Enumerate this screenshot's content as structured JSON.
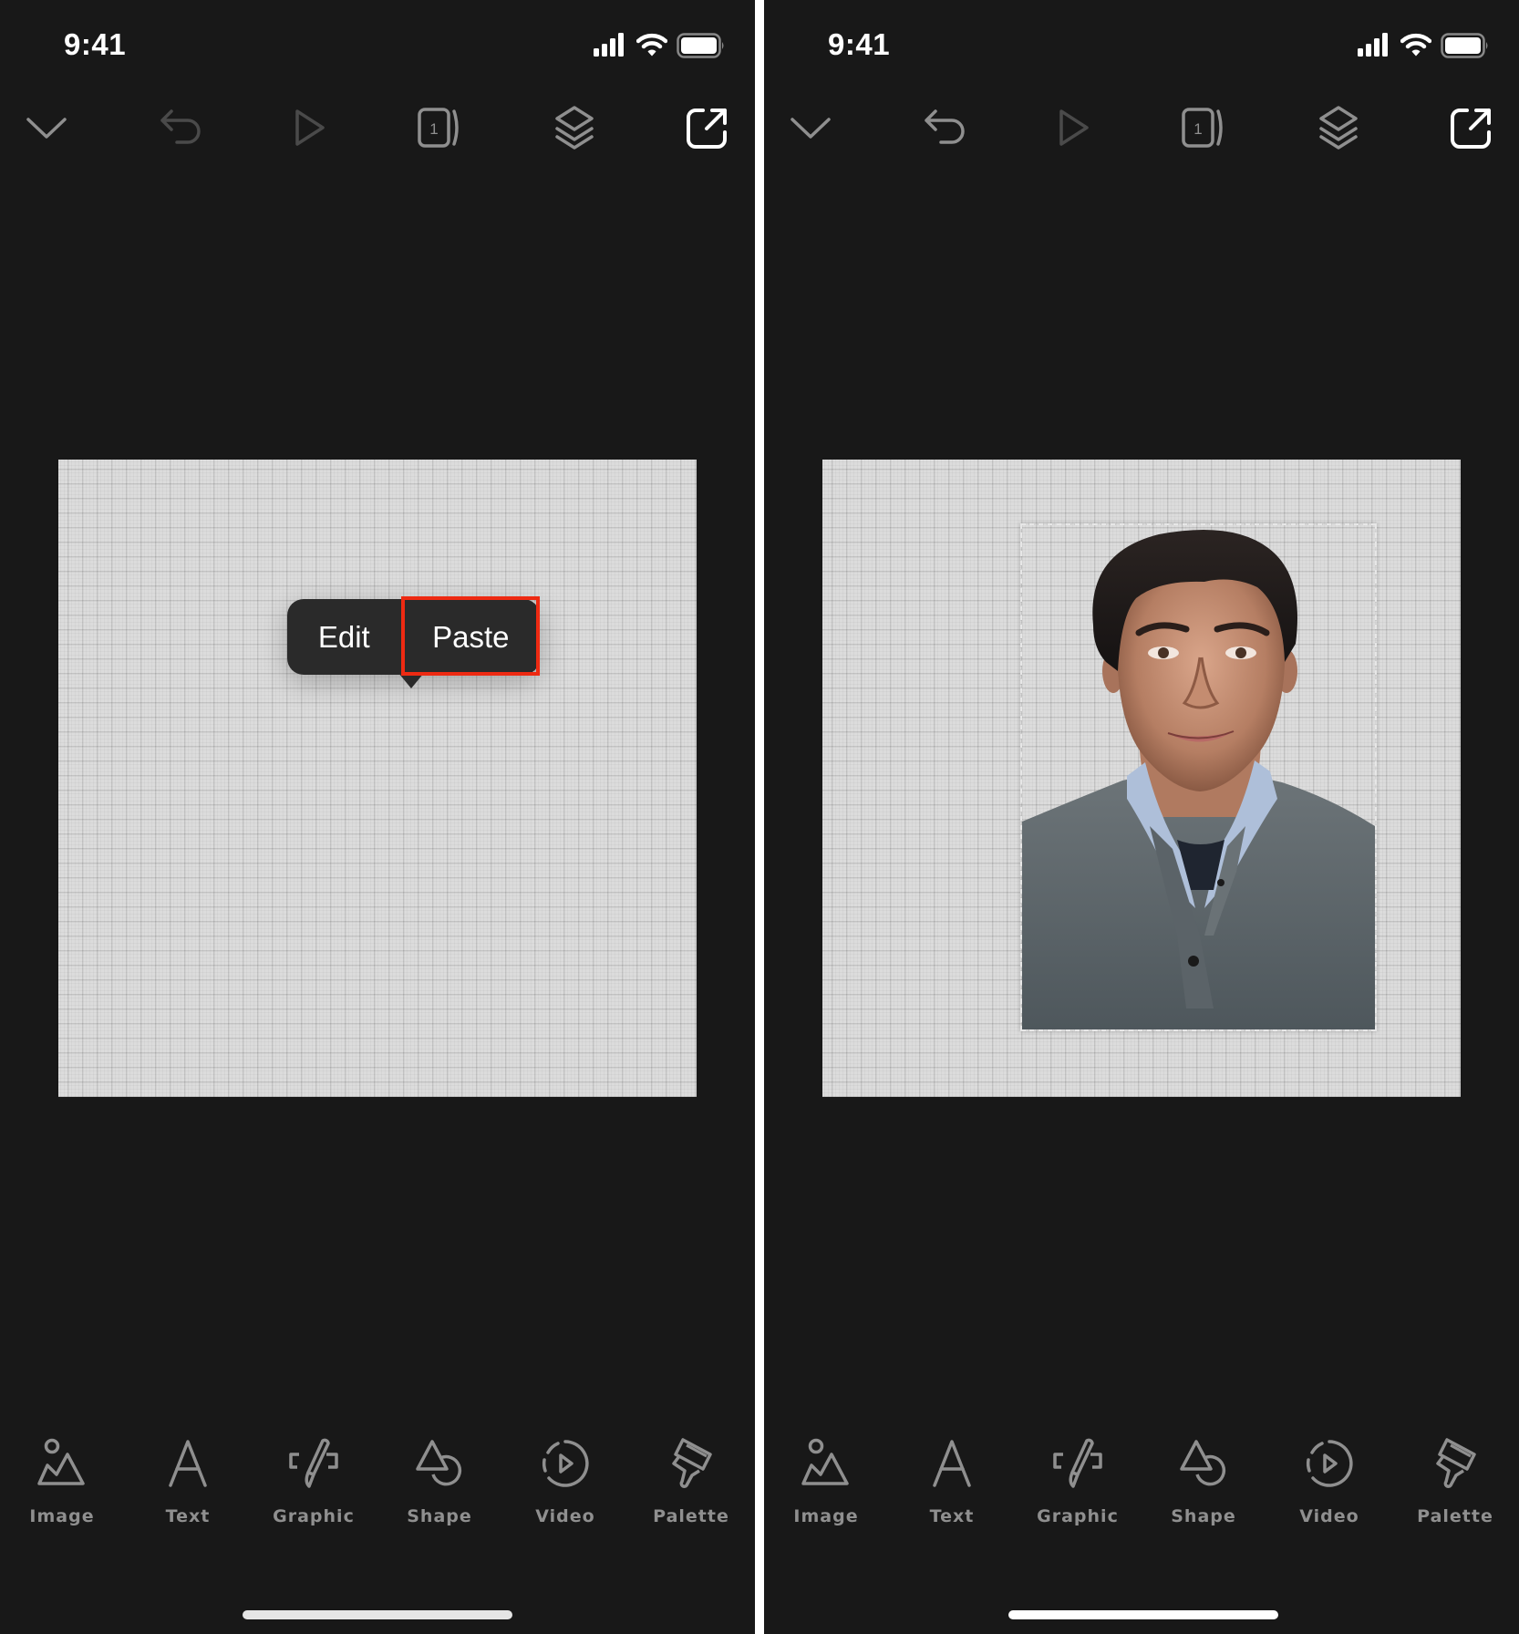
{
  "colors": {
    "background": "#181818",
    "icon_active": "#8f8f8f",
    "icon_disabled": "#4a4a4a",
    "accent_white": "#ffffff",
    "popup_bg": "#2a2a2a",
    "highlight_red": "#ee2a12",
    "canvas_bg": "#dcdcdc"
  },
  "panels": [
    {
      "id": "before",
      "status_bar": {
        "time": "9:41",
        "icons": [
          "cellular-signal-icon",
          "wifi-icon",
          "battery-icon"
        ]
      },
      "top_toolbar": [
        {
          "name": "collapse",
          "icon": "chevron-down-icon",
          "enabled": true
        },
        {
          "name": "undo",
          "icon": "undo-icon",
          "enabled": false
        },
        {
          "name": "preview",
          "icon": "play-icon",
          "enabled": false
        },
        {
          "name": "pages",
          "icon": "pages-icon",
          "page_number": "1",
          "enabled": true
        },
        {
          "name": "layers",
          "icon": "layers-icon",
          "enabled": true
        },
        {
          "name": "share",
          "icon": "share-icon",
          "enabled": true
        }
      ],
      "canvas": {
        "state": "empty"
      },
      "context_menu": {
        "items": [
          {
            "label": "Edit"
          },
          {
            "label": "Paste",
            "highlighted": true
          }
        ]
      },
      "bottom_toolbar": [
        {
          "label": "Image",
          "icon": "image-icon"
        },
        {
          "label": "Text",
          "icon": "text-icon"
        },
        {
          "label": "Graphic",
          "icon": "graphic-icon"
        },
        {
          "label": "Shape",
          "icon": "shape-icon"
        },
        {
          "label": "Video",
          "icon": "video-icon"
        },
        {
          "label": "Palette",
          "icon": "palette-icon"
        }
      ]
    },
    {
      "id": "after",
      "status_bar": {
        "time": "9:41",
        "icons": [
          "cellular-signal-icon",
          "wifi-icon",
          "battery-icon"
        ]
      },
      "top_toolbar": [
        {
          "name": "collapse",
          "icon": "chevron-down-icon",
          "enabled": true
        },
        {
          "name": "undo",
          "icon": "undo-icon",
          "enabled": true
        },
        {
          "name": "preview",
          "icon": "play-icon",
          "enabled": false
        },
        {
          "name": "pages",
          "icon": "pages-icon",
          "page_number": "1",
          "enabled": true
        },
        {
          "name": "layers",
          "icon": "layers-icon",
          "enabled": true
        },
        {
          "name": "share",
          "icon": "share-icon",
          "enabled": true
        }
      ],
      "canvas": {
        "state": "pasted-image-selected",
        "content": "portrait photo of a smiling man in a gray sweater over a light blue collared shirt"
      },
      "bottom_toolbar": [
        {
          "label": "Image",
          "icon": "image-icon"
        },
        {
          "label": "Text",
          "icon": "text-icon"
        },
        {
          "label": "Graphic",
          "icon": "graphic-icon"
        },
        {
          "label": "Shape",
          "icon": "shape-icon"
        },
        {
          "label": "Video",
          "icon": "video-icon"
        },
        {
          "label": "Palette",
          "icon": "palette-icon"
        }
      ]
    }
  ]
}
